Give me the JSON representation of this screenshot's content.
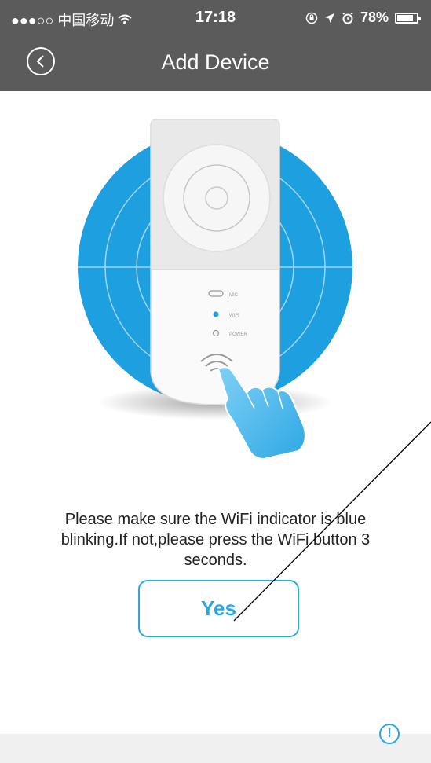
{
  "status_bar": {
    "carrier": "●●●○○ 中国移动",
    "time": "17:18",
    "battery_percent": "78%",
    "battery_level": 0.78
  },
  "nav": {
    "title": "Add Device"
  },
  "device": {
    "mic_label": "MIC",
    "wifi_label": "WIFI",
    "power_label": "POWER"
  },
  "message": "Please make sure the WiFi indicator is blue blinking.If not,please press the WiFi button 3 seconds.",
  "yes_button": "Yes",
  "info_icon": "!",
  "colors": {
    "accent": "#2aa7e3",
    "header": "#5b5b5b",
    "circle": "#1e9fe0"
  }
}
